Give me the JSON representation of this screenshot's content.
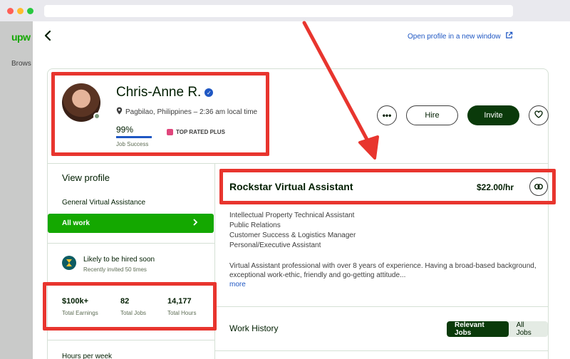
{
  "browser": {
    "url": ""
  },
  "background_page": {
    "logo": "upw",
    "browse": "Brows"
  },
  "modal": {
    "open_window_label": "Open profile in a new window"
  },
  "profile": {
    "name": "Chris-Anne R.",
    "location": "Pagbilao, Philippines – 2:36 am local time",
    "job_success_value": "99%",
    "job_success_fraction": 0.99,
    "job_success_label": "Job Success",
    "badge": "TOP RATED PLUS",
    "more_label": "•••",
    "hire_label": "Hire",
    "invite_label": "Invite"
  },
  "left": {
    "view_profile": "View profile",
    "category": "General Virtual Assistance",
    "all_work": "All work",
    "likely_title": "Likely to be hired soon",
    "likely_sub": "Recently invited 50 times",
    "stats": [
      {
        "value": "$100k+",
        "label": "Total Earnings"
      },
      {
        "value": "82",
        "label": "Total Jobs"
      },
      {
        "value": "14,177",
        "label": "Total Hours"
      }
    ],
    "hours_per_week": "Hours per week"
  },
  "right": {
    "title": "Rockstar Virtual Assistant",
    "rate": "$22.00/hr",
    "specialties": [
      "Intellectual Property Technical Assistant",
      "Public Relations",
      "Customer Success & Logistics Manager",
      "Personal/Executive Assistant"
    ],
    "description": "Virtual Assistant professional with over 8 years of experience. Having a broad-based background, exceptional work-ethic, friendly and go-getting attitude...",
    "more": "more",
    "work_history": "Work History",
    "tabs": [
      "Relevant Jobs",
      "All Jobs"
    ]
  },
  "colors": {
    "accent_green": "#14a800",
    "dark_green": "#0a3a0a",
    "link_blue": "#1f57c3",
    "annotation_red": "#e8352e"
  }
}
